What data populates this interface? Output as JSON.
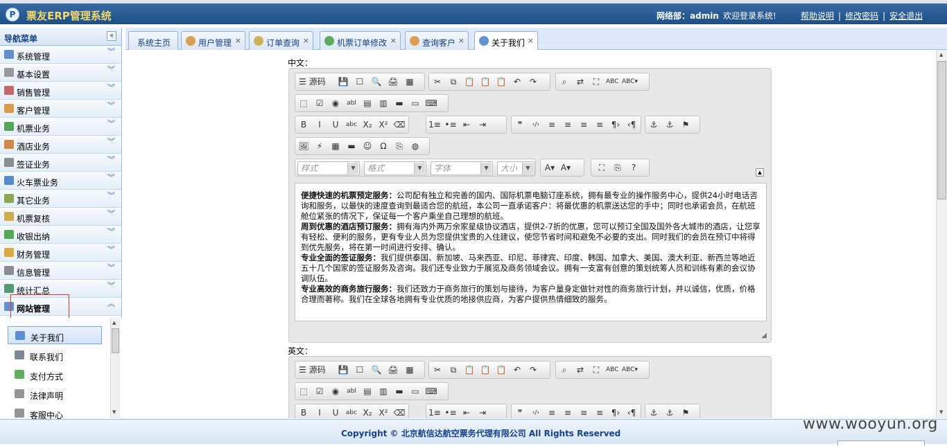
{
  "header": {
    "logo_glyph": "P",
    "title": "票友ERP管理系统",
    "user": "网络部：admin",
    "welcome": "欢迎登录系统!",
    "links": [
      "帮助说明",
      "修改密码",
      "安全退出"
    ]
  },
  "sidebar": {
    "title": "导航菜单",
    "collapse_glyph": "«",
    "items": [
      {
        "label": "系统管理",
        "icon": "monitor-icon",
        "color": "#4a7fc4"
      },
      {
        "label": "基本设置",
        "icon": "gear-icon",
        "color": "#888888"
      },
      {
        "label": "销售管理",
        "icon": "contact-card-icon",
        "color": "#c0504d"
      },
      {
        "label": "客户管理",
        "icon": "users-icon",
        "color": "#d98a2b"
      },
      {
        "label": "机票业务",
        "icon": "globe-icon",
        "color": "#3a9a3a"
      },
      {
        "label": "酒店业务",
        "icon": "house-icon",
        "color": "#c8762b"
      },
      {
        "label": "签证业务",
        "icon": "id-card-icon",
        "color": "#7a7a7a"
      },
      {
        "label": "火车票业务",
        "icon": "train-icon",
        "color": "#3b78c6"
      },
      {
        "label": "其它业务",
        "icon": "clipboard-icon",
        "color": "#7a9a3a"
      },
      {
        "label": "机票复核",
        "icon": "document-check-icon",
        "color": "#c8a030"
      },
      {
        "label": "收银出纳",
        "icon": "yen-icon",
        "color": "#3a9a3a"
      },
      {
        "label": "财务管理",
        "icon": "coins-icon",
        "color": "#d4a020"
      },
      {
        "label": "信息管理",
        "icon": "info-list-icon",
        "color": "#7a7a7a"
      },
      {
        "label": "统计汇总",
        "icon": "org-chart-icon",
        "color": "#3a8a5a"
      },
      {
        "label": "网站管理",
        "icon": "website-chart-icon",
        "color": "#4a7fc4"
      }
    ],
    "chevron_down": "︾",
    "chevron_up": "︽",
    "sub_items": [
      {
        "label": "关于我们",
        "icon": "user-edit-icon",
        "color": "#3b78c6"
      },
      {
        "label": "联系我们",
        "icon": "contacts-icon",
        "color": "#5a6a7a"
      },
      {
        "label": "支付方式",
        "icon": "yen-icon",
        "color": "#3a9a3a"
      },
      {
        "label": "法律声明",
        "icon": "legal-card-icon",
        "color": "#7a7a7a"
      },
      {
        "label": "客服中心",
        "icon": "service-icon",
        "color": "#7a7a7a"
      }
    ]
  },
  "tabs": [
    {
      "label": "系统主页",
      "icon": "",
      "close": ""
    },
    {
      "label": "用户管理",
      "icon": "users-icon",
      "close": "×"
    },
    {
      "label": "订单查询",
      "icon": "order-icon",
      "close": "×"
    },
    {
      "label": "机票订单修改",
      "icon": "globe-icon",
      "close": "×"
    },
    {
      "label": "查询客户",
      "icon": "user-search-icon",
      "close": "×"
    },
    {
      "label": "关于我们",
      "icon": "user-edit-icon",
      "close": "×"
    }
  ],
  "content": {
    "label_cn": "中文：",
    "label_en": "英文：",
    "toolbar": {
      "source_label": "源码",
      "style_placeholder": "样式",
      "format_placeholder": "格式",
      "font_placeholder": "字体",
      "size_placeholder": "大小",
      "row1": [
        "💾",
        "☐",
        "🔍",
        "🖨",
        "▦",
        "✂",
        "⧉",
        "📋",
        "📋",
        "📋",
        "↶",
        "↷",
        "⌕",
        "⇄",
        "⛶",
        "ABC",
        "ABC▾"
      ],
      "row2": [
        "⬚",
        "☑",
        "◉",
        "abl",
        "▤",
        "▥",
        "▬",
        "▭",
        "⌨"
      ],
      "row3": [
        "B",
        "I",
        "U",
        "abc",
        "X₂",
        "X²",
        "⌫",
        "1≡",
        "•≡",
        "⇤",
        "⇥",
        "❞",
        "‹/›",
        "≡",
        "≡",
        "≡",
        "≡",
        "¶›",
        "‹¶",
        "⚓",
        "⚓",
        "⚑"
      ],
      "row4": [
        "🖼",
        "⚡",
        "▦",
        "▬",
        "☺",
        "Ω",
        "⎘",
        "◍"
      ],
      "row5": [
        "A▾",
        "A▾",
        "⛶",
        "⎘",
        "?"
      ]
    },
    "paragraphs": [
      {
        "title": "便捷快速的机票预定服务：",
        "body": "公司配有独立和完善的国内、国际机票电脑订座系统，拥有最专业的操作服务中心，提供24小时电话咨询和服务，以最快的速度查询到最适合您的航班，本公司一直承诺客户：将最优惠的机票送达您的手中；同时也承诺会员，在航班舱位紧张的情况下，保证每一个客户乘坐自己理想的航班。"
      },
      {
        "title": "周到优惠的酒店预订服务：",
        "body": "拥有海内外两万余家星级协议酒店，提供2-7折的优惠，您可以预订全国及国外各大城市的酒店，让您享有轻松、便利的服务，更有专业人员为您提供宝贵的入住建议，使您节省时间和避免不必要的支出。同时我们的会员在预订中将得到优先服务，将在第一时间进行安排、确认。"
      },
      {
        "title": "专业全面的签证服务：",
        "body": "我们提供泰国、新加坡、马来西亚、印尼、菲律宾、印度、韩国、加拿大、美国、澳大利亚、新西兰等地近五十几个国家的签证服务及咨询。我们还专业致力于展览及商务领域会议。拥有一支富有创意的策划统筹人员和训练有素的会议协调队伍。"
      },
      {
        "title": "专业高效的商务旅行服务：",
        "body": "我们还致力于商务旅行的策划与接待，为客户量身定做针对性的商务旅行计划，并以诚信，优质，价格合理而著称。我们在全球各地拥有专业优质的地接供应商，为客户提供热情细致的服务。"
      }
    ]
  },
  "footer": {
    "copyright": "Copyright © 北京航信达航空票务代理有限公司 All Rights Reserved",
    "watermark": "www.wooyun.org"
  }
}
